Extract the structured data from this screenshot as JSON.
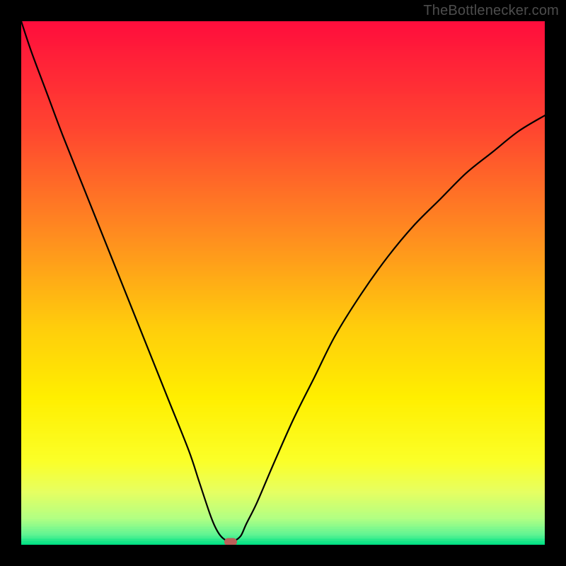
{
  "watermark": "TheBottlenecker.com",
  "chart_data": {
    "type": "line",
    "title": "",
    "xlabel": "",
    "ylabel": "",
    "xlim": [
      0,
      100
    ],
    "ylim": [
      0,
      100
    ],
    "x": [
      0,
      2,
      5,
      8,
      12,
      16,
      20,
      24,
      28,
      32,
      34,
      36,
      37,
      38,
      39,
      40,
      41,
      42,
      43,
      45,
      48,
      52,
      56,
      60,
      65,
      70,
      75,
      80,
      85,
      90,
      95,
      100
    ],
    "y": [
      100,
      94,
      86,
      78,
      68,
      58,
      48,
      38,
      28,
      18,
      12,
      6,
      3.5,
      1.8,
      0.9,
      0.5,
      0.9,
      1.8,
      4,
      8,
      15,
      24,
      32,
      40,
      48,
      55,
      61,
      66,
      71,
      75,
      79,
      82
    ],
    "marker": {
      "x": 40,
      "y": 0.5,
      "color": "#bb5f59"
    },
    "gradient_stops": [
      {
        "pos": 0,
        "color": "#ff0e3c"
      },
      {
        "pos": 20,
        "color": "#ff4430"
      },
      {
        "pos": 40,
        "color": "#ff8a20"
      },
      {
        "pos": 58,
        "color": "#ffcc0c"
      },
      {
        "pos": 72,
        "color": "#ffef00"
      },
      {
        "pos": 84,
        "color": "#fbff28"
      },
      {
        "pos": 90,
        "color": "#e6ff62"
      },
      {
        "pos": 95,
        "color": "#b2ff83"
      },
      {
        "pos": 98,
        "color": "#63f593"
      },
      {
        "pos": 100,
        "color": "#00e184"
      }
    ]
  }
}
